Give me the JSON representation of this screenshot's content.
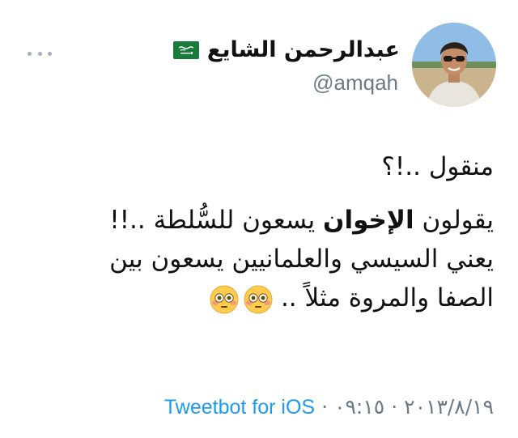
{
  "author": {
    "display_name": "عبدالرحمن الشايع",
    "handle": "@amqah",
    "flag_icon": "saudi-flag-icon"
  },
  "tweet": {
    "line1": "منقول ..!؟",
    "line2_part1": "يقولون ",
    "line2_bold": "الإخوان",
    "line2_part2": " يسعون للسُّلطة ..!!",
    "line3": "يعني السيسي والعلمانيين يسعون بين",
    "line4": "الصفا والمروة مثلاً ..",
    "emojis": [
      "flushed-face-emoji",
      "flushed-face-emoji"
    ]
  },
  "meta": {
    "date": "٢٠١٣/٨/١٩",
    "separator": "·",
    "time": "٠٩:١٥",
    "source": "Tweetbot for iOS"
  },
  "colors": {
    "link": "#1d9bf0",
    "muted": "#6c7a86",
    "text": "#111111"
  }
}
